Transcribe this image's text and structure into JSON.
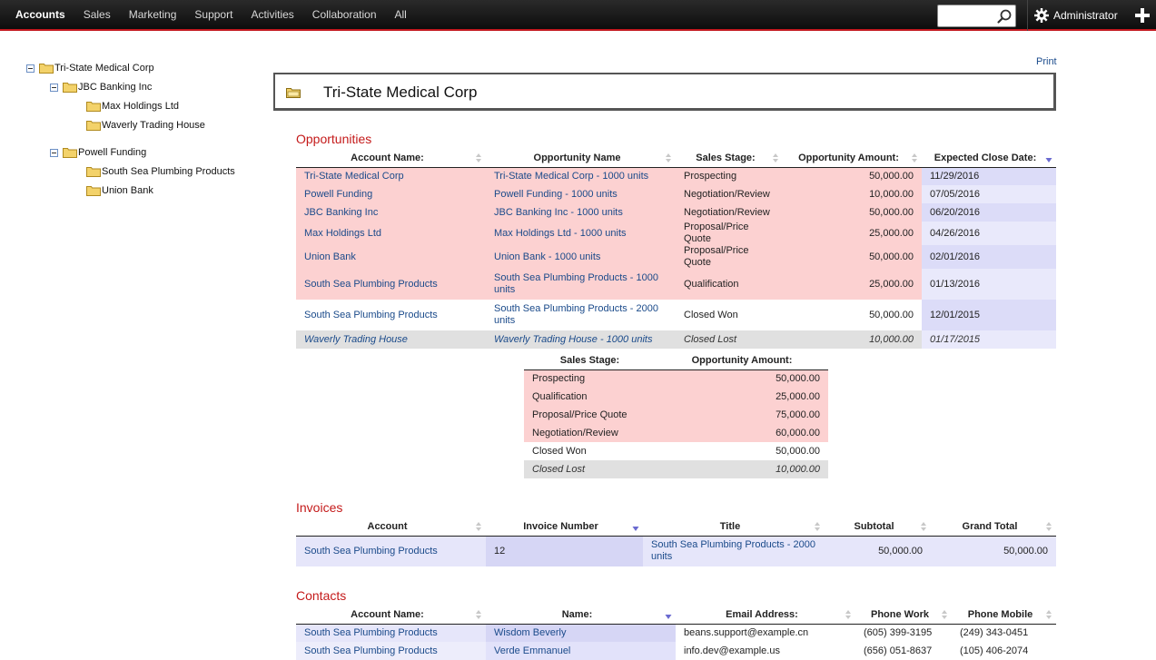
{
  "nav": {
    "items": [
      "Accounts",
      "Sales",
      "Marketing",
      "Support",
      "Activities",
      "Collaboration",
      "All"
    ],
    "search_placeholder": "",
    "admin_label": "Administrator"
  },
  "tree": [
    {
      "label": "Tri-State Medical Corp",
      "level": 0,
      "toggle": true
    },
    {
      "label": "JBC Banking Inc",
      "level": 1,
      "toggle": true
    },
    {
      "label": "Max Holdings Ltd",
      "level": 2,
      "toggle": false
    },
    {
      "label": "Waverly Trading House",
      "level": 2,
      "toggle": false
    },
    {
      "label": "Powell Funding",
      "level": 1,
      "toggle": true
    },
    {
      "label": "South Sea Plumbing Products",
      "level": 2,
      "toggle": false
    },
    {
      "label": "Union Bank",
      "level": 2,
      "toggle": false
    }
  ],
  "main": {
    "print_label": "Print",
    "title": "Tri-State Medical Corp"
  },
  "opportunities": {
    "title": "Opportunities",
    "headers": [
      "Account Name:",
      "Opportunity Name",
      "Sales Stage:",
      "Opportunity Amount:",
      "Expected Close Date:"
    ],
    "rows": [
      {
        "account": "Tri-State Medical Corp",
        "name": "Tri-State Medical Corp - 1000 units",
        "stage": "Prospecting",
        "amount": "50,000.00",
        "date": "11/29/2016",
        "style": "pink"
      },
      {
        "account": "Powell Funding",
        "name": "Powell Funding - 1000 units",
        "stage": "Negotiation/Review",
        "amount": "10,000.00",
        "date": "07/05/2016",
        "style": "pink"
      },
      {
        "account": "JBC Banking Inc",
        "name": "JBC Banking Inc - 1000 units",
        "stage": "Negotiation/Review",
        "amount": "50,000.00",
        "date": "06/20/2016",
        "style": "pink"
      },
      {
        "account": "Max Holdings Ltd",
        "name": "Max Holdings Ltd - 1000 units",
        "stage": "Proposal/Price Quote",
        "amount": "25,000.00",
        "date": "04/26/2016",
        "style": "pink"
      },
      {
        "account": "Union Bank",
        "name": "Union Bank - 1000 units",
        "stage": "Proposal/Price Quote",
        "amount": "50,000.00",
        "date": "02/01/2016",
        "style": "pink"
      },
      {
        "account": "South Sea Plumbing Products",
        "name": "South Sea Plumbing Products - 1000 units",
        "stage": "Qualification",
        "amount": "25,000.00",
        "date": "01/13/2016",
        "style": "pink"
      },
      {
        "account": "South Sea Plumbing Products",
        "name": "South Sea Plumbing Products - 2000 units",
        "stage": "Closed Won",
        "amount": "50,000.00",
        "date": "12/01/2015",
        "style": "white"
      },
      {
        "account": "Waverly Trading House",
        "name": "Waverly Trading House - 1000 units",
        "stage": "Closed Lost",
        "amount": "10,000.00",
        "date": "01/17/2015",
        "style": "grey"
      }
    ]
  },
  "summary": {
    "headers": [
      "Sales Stage:",
      "Opportunity Amount:"
    ],
    "rows": [
      {
        "stage": "Prospecting",
        "amount": "50,000.00",
        "style": "pink"
      },
      {
        "stage": "Qualification",
        "amount": "25,000.00",
        "style": "pink"
      },
      {
        "stage": "Proposal/Price Quote",
        "amount": "75,000.00",
        "style": "pink"
      },
      {
        "stage": "Negotiation/Review",
        "amount": "60,000.00",
        "style": "pink"
      },
      {
        "stage": "Closed Won",
        "amount": "50,000.00",
        "style": "white"
      },
      {
        "stage": "Closed Lost",
        "amount": "10,000.00",
        "style": "grey"
      }
    ]
  },
  "invoices": {
    "title": "Invoices",
    "headers": [
      "Account",
      "Invoice Number",
      "Title",
      "Subtotal",
      "Grand Total"
    ],
    "rows": [
      {
        "account": "South Sea Plumbing Products",
        "number": "12",
        "title": "South Sea Plumbing Products - 2000 units",
        "subtotal": "50,000.00",
        "total": "50,000.00"
      }
    ]
  },
  "contacts": {
    "title": "Contacts",
    "headers": [
      "Account Name:",
      "Name:",
      "Email Address:",
      "Phone Work",
      "Phone Mobile"
    ],
    "rows": [
      {
        "account": "South Sea Plumbing Products",
        "name": "Wisdom Beverly",
        "email": "beans.support@example.cn",
        "work": "(605) 399-3195",
        "mobile": "(249) 343-0451"
      },
      {
        "account": "South Sea Plumbing Products",
        "name": "Verde Emmanuel",
        "email": "info.dev@example.us",
        "work": "(656) 051-8637",
        "mobile": "(105) 406-2074"
      }
    ]
  }
}
